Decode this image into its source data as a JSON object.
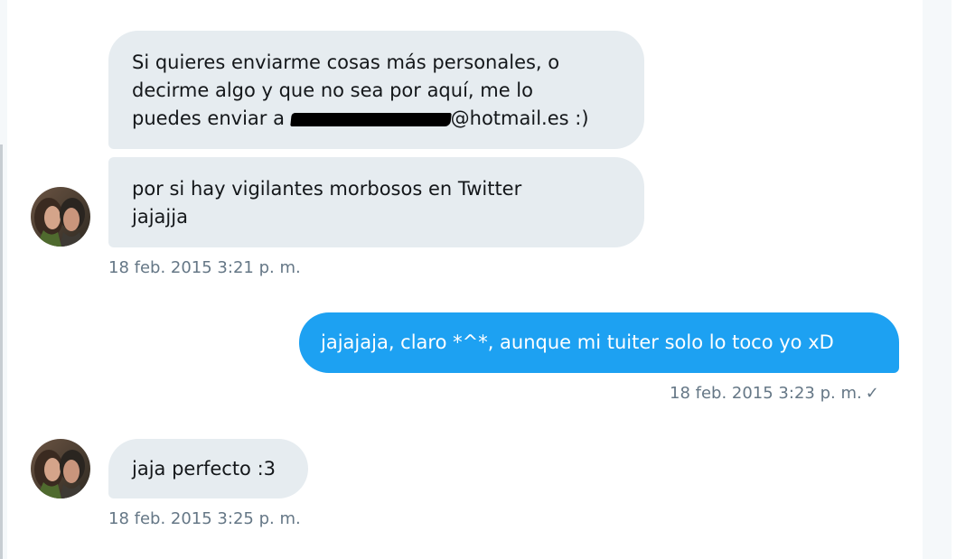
{
  "conversation": {
    "messages": [
      {
        "direction": "received",
        "lines": [
          "Si quieres enviarme cosas más personales, o",
          "decirme algo y que no sea por aquí, me lo",
          "puedes enviar a "
        ],
        "email_suffix": "@hotmail.es :)"
      },
      {
        "direction": "received",
        "lines": [
          "por si hay vigilantes morbosos en Twitter",
          "jajajja"
        ]
      },
      {
        "direction": "sent",
        "text": "jajajaja, claro *^*, aunque mi tuiter solo lo toco yo xD"
      },
      {
        "direction": "received",
        "text": "jaja perfecto :3"
      }
    ],
    "timestamps": {
      "group1": "18 feb. 2015 3:21 p. m.",
      "sent": "18 feb. 2015 3:23 p. m.",
      "group2": "18 feb. 2015 3:25 p. m."
    },
    "read_mark": "✓"
  },
  "colors": {
    "received_bubble": "#e6ecf0",
    "sent_bubble": "#1da1f2",
    "timestamp": "#657786"
  }
}
